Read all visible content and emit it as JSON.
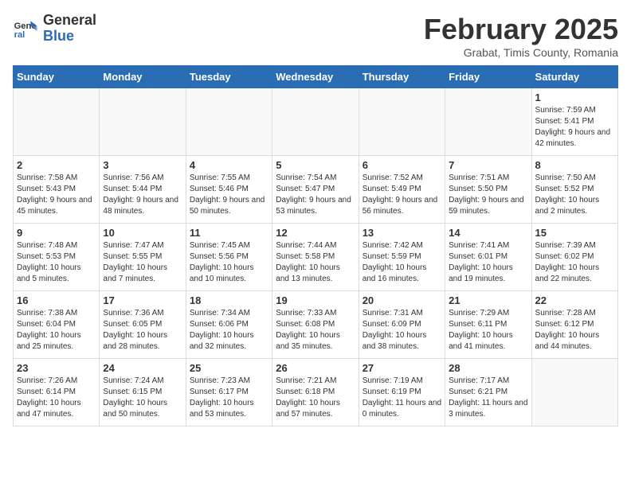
{
  "header": {
    "logo_general": "General",
    "logo_blue": "Blue",
    "month_title": "February 2025",
    "location": "Grabat, Timis County, Romania"
  },
  "weekdays": [
    "Sunday",
    "Monday",
    "Tuesday",
    "Wednesday",
    "Thursday",
    "Friday",
    "Saturday"
  ],
  "weeks": [
    [
      {
        "day": "",
        "info": ""
      },
      {
        "day": "",
        "info": ""
      },
      {
        "day": "",
        "info": ""
      },
      {
        "day": "",
        "info": ""
      },
      {
        "day": "",
        "info": ""
      },
      {
        "day": "",
        "info": ""
      },
      {
        "day": "1",
        "info": "Sunrise: 7:59 AM\nSunset: 5:41 PM\nDaylight: 9 hours and 42 minutes."
      }
    ],
    [
      {
        "day": "2",
        "info": "Sunrise: 7:58 AM\nSunset: 5:43 PM\nDaylight: 9 hours and 45 minutes."
      },
      {
        "day": "3",
        "info": "Sunrise: 7:56 AM\nSunset: 5:44 PM\nDaylight: 9 hours and 48 minutes."
      },
      {
        "day": "4",
        "info": "Sunrise: 7:55 AM\nSunset: 5:46 PM\nDaylight: 9 hours and 50 minutes."
      },
      {
        "day": "5",
        "info": "Sunrise: 7:54 AM\nSunset: 5:47 PM\nDaylight: 9 hours and 53 minutes."
      },
      {
        "day": "6",
        "info": "Sunrise: 7:52 AM\nSunset: 5:49 PM\nDaylight: 9 hours and 56 minutes."
      },
      {
        "day": "7",
        "info": "Sunrise: 7:51 AM\nSunset: 5:50 PM\nDaylight: 9 hours and 59 minutes."
      },
      {
        "day": "8",
        "info": "Sunrise: 7:50 AM\nSunset: 5:52 PM\nDaylight: 10 hours and 2 minutes."
      }
    ],
    [
      {
        "day": "9",
        "info": "Sunrise: 7:48 AM\nSunset: 5:53 PM\nDaylight: 10 hours and 5 minutes."
      },
      {
        "day": "10",
        "info": "Sunrise: 7:47 AM\nSunset: 5:55 PM\nDaylight: 10 hours and 7 minutes."
      },
      {
        "day": "11",
        "info": "Sunrise: 7:45 AM\nSunset: 5:56 PM\nDaylight: 10 hours and 10 minutes."
      },
      {
        "day": "12",
        "info": "Sunrise: 7:44 AM\nSunset: 5:58 PM\nDaylight: 10 hours and 13 minutes."
      },
      {
        "day": "13",
        "info": "Sunrise: 7:42 AM\nSunset: 5:59 PM\nDaylight: 10 hours and 16 minutes."
      },
      {
        "day": "14",
        "info": "Sunrise: 7:41 AM\nSunset: 6:01 PM\nDaylight: 10 hours and 19 minutes."
      },
      {
        "day": "15",
        "info": "Sunrise: 7:39 AM\nSunset: 6:02 PM\nDaylight: 10 hours and 22 minutes."
      }
    ],
    [
      {
        "day": "16",
        "info": "Sunrise: 7:38 AM\nSunset: 6:04 PM\nDaylight: 10 hours and 25 minutes."
      },
      {
        "day": "17",
        "info": "Sunrise: 7:36 AM\nSunset: 6:05 PM\nDaylight: 10 hours and 28 minutes."
      },
      {
        "day": "18",
        "info": "Sunrise: 7:34 AM\nSunset: 6:06 PM\nDaylight: 10 hours and 32 minutes."
      },
      {
        "day": "19",
        "info": "Sunrise: 7:33 AM\nSunset: 6:08 PM\nDaylight: 10 hours and 35 minutes."
      },
      {
        "day": "20",
        "info": "Sunrise: 7:31 AM\nSunset: 6:09 PM\nDaylight: 10 hours and 38 minutes."
      },
      {
        "day": "21",
        "info": "Sunrise: 7:29 AM\nSunset: 6:11 PM\nDaylight: 10 hours and 41 minutes."
      },
      {
        "day": "22",
        "info": "Sunrise: 7:28 AM\nSunset: 6:12 PM\nDaylight: 10 hours and 44 minutes."
      }
    ],
    [
      {
        "day": "23",
        "info": "Sunrise: 7:26 AM\nSunset: 6:14 PM\nDaylight: 10 hours and 47 minutes."
      },
      {
        "day": "24",
        "info": "Sunrise: 7:24 AM\nSunset: 6:15 PM\nDaylight: 10 hours and 50 minutes."
      },
      {
        "day": "25",
        "info": "Sunrise: 7:23 AM\nSunset: 6:17 PM\nDaylight: 10 hours and 53 minutes."
      },
      {
        "day": "26",
        "info": "Sunrise: 7:21 AM\nSunset: 6:18 PM\nDaylight: 10 hours and 57 minutes."
      },
      {
        "day": "27",
        "info": "Sunrise: 7:19 AM\nSunset: 6:19 PM\nDaylight: 11 hours and 0 minutes."
      },
      {
        "day": "28",
        "info": "Sunrise: 7:17 AM\nSunset: 6:21 PM\nDaylight: 11 hours and 3 minutes."
      },
      {
        "day": "",
        "info": ""
      }
    ]
  ]
}
